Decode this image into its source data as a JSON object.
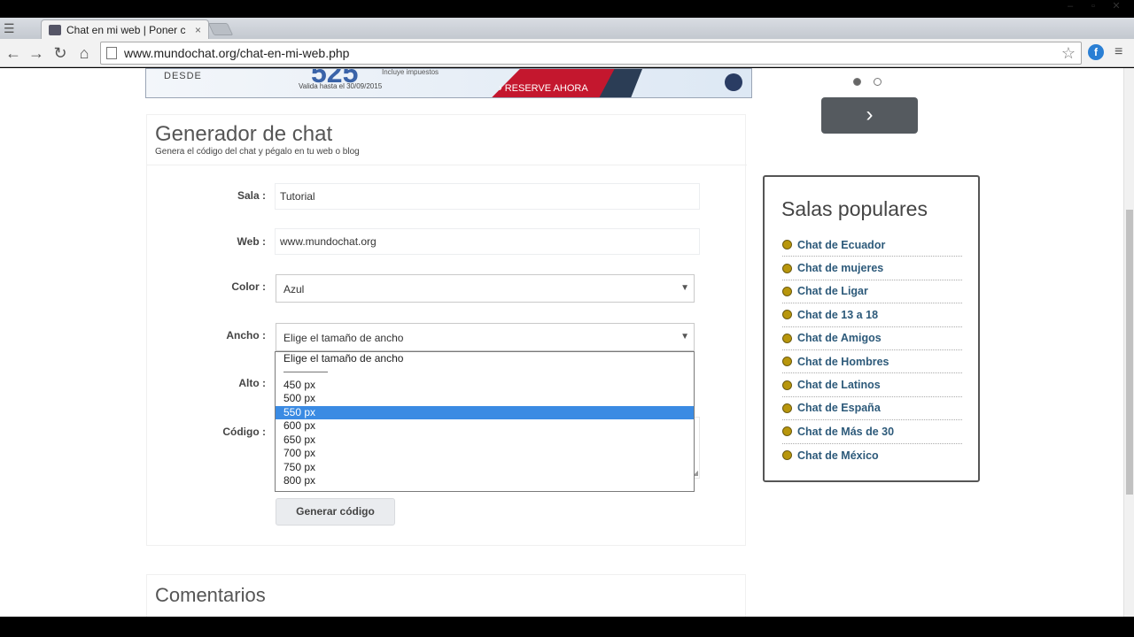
{
  "browser": {
    "tab_title": "Chat en mi web | Poner c",
    "tab_close": "×",
    "url": "www.mundochat.org/chat-en-mi-web.php",
    "window_controls": [
      "–",
      "▫",
      "✕"
    ]
  },
  "banner": {
    "desde": "DESDE",
    "price": "525",
    "tax_note": "Incluye impuestos",
    "validity": "Valida hasta el 30/09/2015",
    "cta": "› RESERVE AHORA"
  },
  "carousel": {
    "next_glyph": "›"
  },
  "generator": {
    "title": "Generador de chat",
    "subtitle": "Genera el código del chat y pégalo en tu web o blog",
    "fields": {
      "sala_label": "Sala :",
      "sala_value": "Tutorial",
      "web_label": "Web :",
      "web_value": "www.mundochat.org",
      "color_label": "Color :",
      "color_value": "Azul",
      "ancho_label": "Ancho :",
      "ancho_value": "Elige el tamaño de ancho",
      "alto_label": "Alto :",
      "codigo_label": "Código :"
    },
    "dropdown": {
      "header": "Elige el tamaño de ancho",
      "options": [
        "450 px",
        "500 px",
        "550 px",
        "600 px",
        "650 px",
        "700 px",
        "750 px",
        "800 px"
      ],
      "selected": "550 px"
    },
    "button": "Generar código"
  },
  "comments": {
    "title": "Comentarios"
  },
  "salas": {
    "title": "Salas populares",
    "items": [
      "Chat de Ecuador",
      "Chat de mujeres",
      "Chat de Ligar",
      "Chat de 13 a 18",
      "Chat de Amigos",
      "Chat de Hombres",
      "Chat de Latinos",
      "Chat de España",
      "Chat de Más de 30",
      "Chat de México"
    ]
  }
}
